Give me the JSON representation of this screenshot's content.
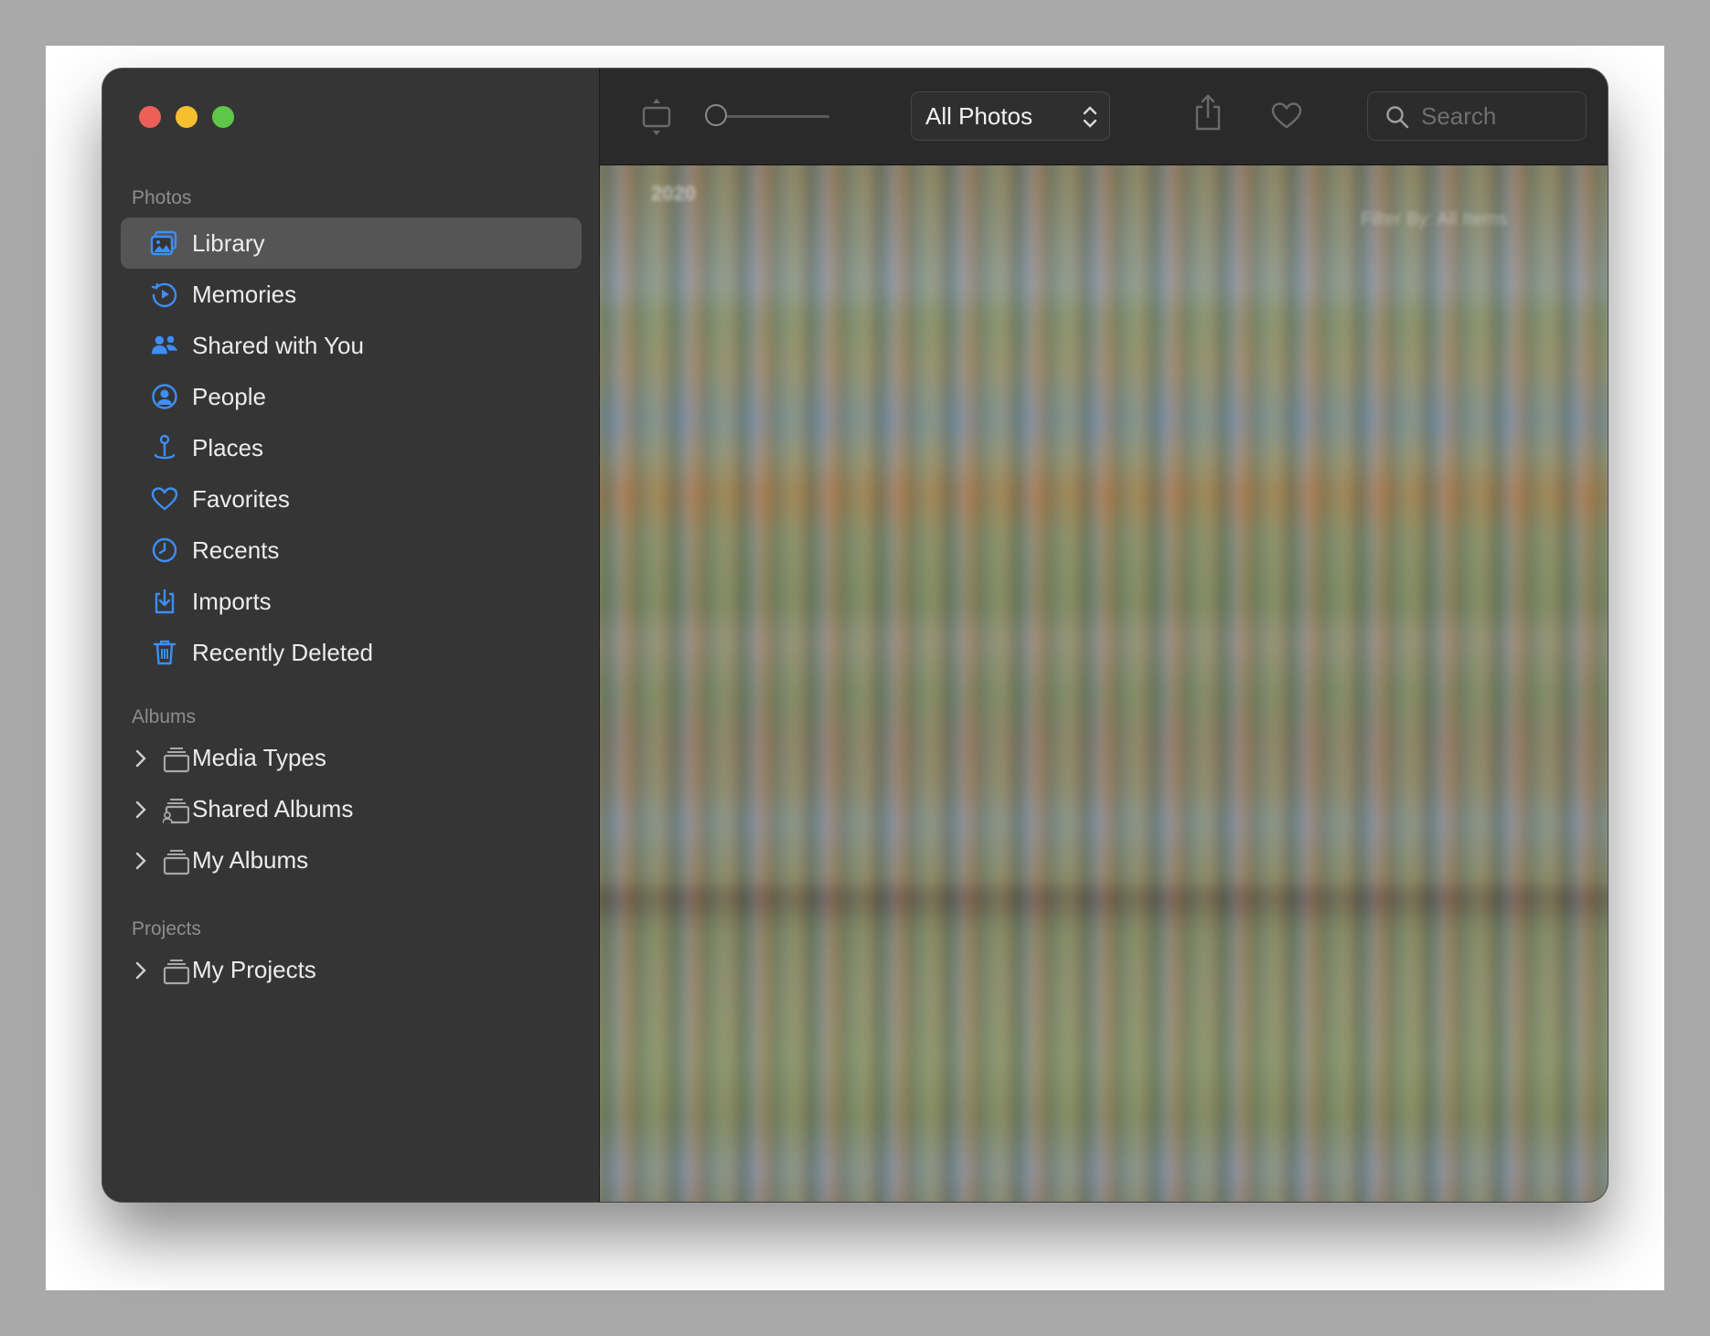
{
  "window": {
    "traffic_lights": {
      "close": "#ed5f57",
      "minimize": "#f5bf2f",
      "zoom": "#5fc748"
    }
  },
  "sidebar": {
    "sections": [
      {
        "title": "Photos",
        "items": [
          {
            "label": "Library",
            "icon": "photo-library-icon",
            "selected": true
          },
          {
            "label": "Memories",
            "icon": "memories-icon"
          },
          {
            "label": "Shared with You",
            "icon": "shared-with-you-icon"
          },
          {
            "label": "People",
            "icon": "person-circle-icon"
          },
          {
            "label": "Places",
            "icon": "map-pin-icon"
          },
          {
            "label": "Favorites",
            "icon": "heart-icon"
          },
          {
            "label": "Recents",
            "icon": "clock-icon"
          },
          {
            "label": "Imports",
            "icon": "import-icon"
          },
          {
            "label": "Recently Deleted",
            "icon": "trash-icon"
          }
        ]
      },
      {
        "title": "Albums",
        "items": [
          {
            "label": "Media Types",
            "icon": "stacked-folder-icon"
          },
          {
            "label": "Shared Albums",
            "icon": "shared-stacked-folder-icon"
          },
          {
            "label": "My Albums",
            "icon": "stacked-folder-icon"
          }
        ]
      },
      {
        "title": "Projects",
        "items": [
          {
            "label": "My Projects",
            "icon": "stacked-folder-icon"
          }
        ]
      }
    ],
    "accent_color": "#3d8ef7"
  },
  "toolbar": {
    "view_selector": "All Photos",
    "search_placeholder": "Search",
    "icons": [
      "slideshow-frame-icon",
      "zoom-slider",
      "share-icon",
      "favorite-heart-icon",
      "search-icon"
    ]
  },
  "grid": {
    "year_label": "2020",
    "filter_label": "Filter By: All Items"
  }
}
